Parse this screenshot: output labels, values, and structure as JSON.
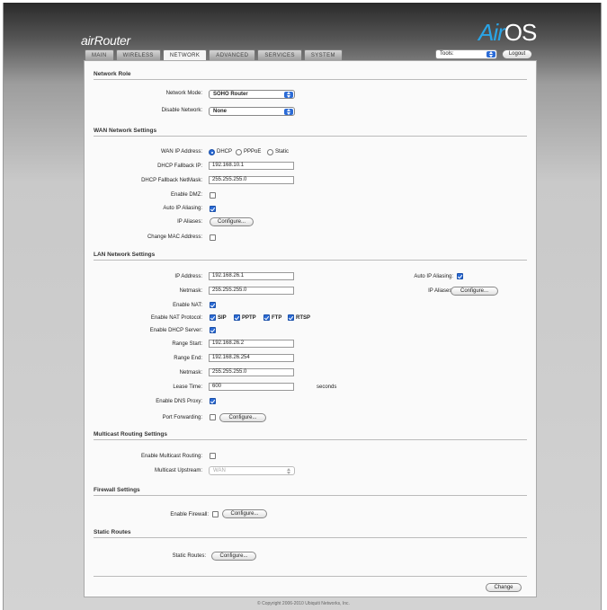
{
  "header": {
    "product": "airRouter",
    "os_logo_prefix": "Air",
    "os_logo_suffix": "OS"
  },
  "tabs": [
    "MAIN",
    "WIRELESS",
    "NETWORK",
    "ADVANCED",
    "SERVICES",
    "SYSTEM"
  ],
  "tools": {
    "label": "Tools:",
    "logout": "Logout"
  },
  "network_role": {
    "title": "Network Role",
    "mode_label": "Network Mode:",
    "mode_value": "SOHO Router",
    "disable_label": "Disable Network:",
    "disable_value": "None"
  },
  "wan": {
    "title": "WAN Network Settings",
    "ip_address_label": "WAN IP Address:",
    "ip_options": [
      "DHCP",
      "PPPoE",
      "Static"
    ],
    "fallback_ip_label": "DHCP Fallback IP:",
    "fallback_ip": "192.168.10.1",
    "fallback_mask_label": "DHCP Fallback NetMask:",
    "fallback_mask": "255.255.255.0",
    "dmz_label": "Enable DMZ:",
    "auto_alias_label": "Auto IP Aliasing:",
    "ip_aliases_label": "IP Aliases:",
    "configure": "Configure...",
    "change_mac_label": "Change MAC Address:"
  },
  "lan": {
    "title": "LAN Network Settings",
    "ip_label": "IP Address:",
    "ip": "192.168.26.1",
    "netmask_label": "Netmask:",
    "netmask": "255.255.255.0",
    "nat_label": "Enable NAT:",
    "nat_protocol_label": "Enable NAT Protocol:",
    "nat_protocols": [
      "SIP",
      "PPTP",
      "FTP",
      "RTSP"
    ],
    "dhcp_label": "Enable DHCP Server:",
    "range_start_label": "Range Start:",
    "range_start": "192.168.26.2",
    "range_end_label": "Range End:",
    "range_end": "192.168.26.254",
    "dhcp_netmask_label": "Netmask:",
    "dhcp_netmask": "255.255.255.0",
    "lease_label": "Lease Time:",
    "lease": "600",
    "lease_unit": "seconds",
    "dns_proxy_label": "Enable DNS Proxy:",
    "port_fwd_label": "Port Forwarding:",
    "configure": "Configure...",
    "auto_alias_label": "Auto IP Aliasing:",
    "ip_aliases_label": "IP Aliases:"
  },
  "multicast": {
    "title": "Multicast Routing Settings",
    "enable_label": "Enable Multicast Routing:",
    "upstream_label": "Multicast Upstream:",
    "upstream_value": "WAN"
  },
  "firewall": {
    "title": "Firewall Settings",
    "enable_label": "Enable Firewall:",
    "configure": "Configure..."
  },
  "static_routes": {
    "title": "Static Routes",
    "label": "Static Routes:",
    "configure": "Configure..."
  },
  "footer": {
    "change": "Change",
    "copyright": "© Copyright 2006-2010 Ubiquiti Networks, Inc."
  },
  "colors": {
    "accent": "#2b6bd6",
    "logo_blue": "#2aa4e6"
  }
}
